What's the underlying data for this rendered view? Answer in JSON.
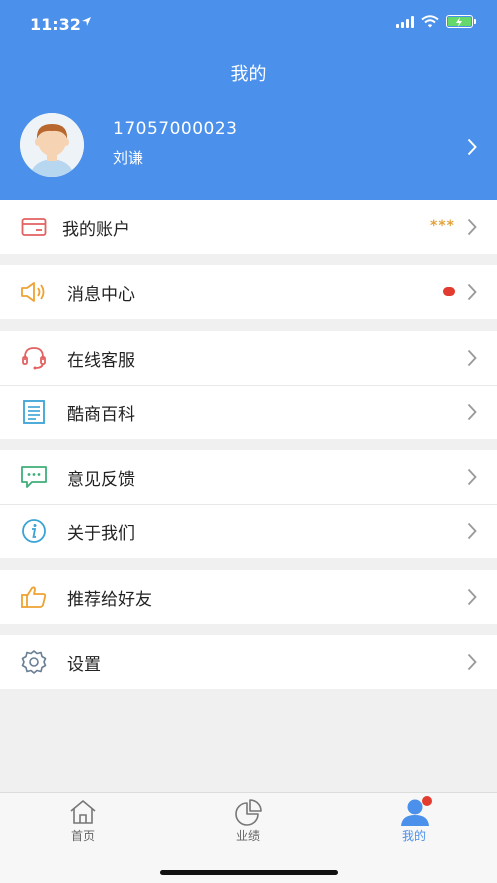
{
  "status": {
    "time": "11:32"
  },
  "header": {
    "title": "我的"
  },
  "profile": {
    "phone": "17057000023",
    "name": "刘谦"
  },
  "menu": {
    "account": {
      "label": "我的账户",
      "value": "***"
    },
    "messages": {
      "label": "消息中心"
    },
    "service": {
      "label": "在线客服"
    },
    "wiki": {
      "label": "酷商百科"
    },
    "feedback": {
      "label": "意见反馈"
    },
    "about": {
      "label": "关于我们"
    },
    "recommend": {
      "label": "推荐给好友"
    },
    "settings": {
      "label": "设置"
    }
  },
  "tabs": [
    {
      "label": "首页",
      "icon": "home-icon"
    },
    {
      "label": "业绩",
      "icon": "pie-chart-icon"
    },
    {
      "label": "我的",
      "icon": "user-icon"
    }
  ],
  "colors": {
    "primary": "#4b90ea",
    "badge": "#e23b2f",
    "stars": "#e2a33a"
  }
}
